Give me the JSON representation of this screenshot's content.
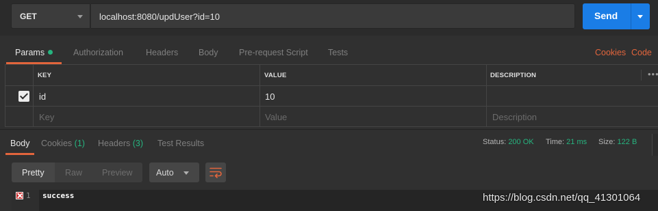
{
  "request": {
    "method": "GET",
    "url": "localhost:8080/updUser?id=10",
    "send_label": "Send"
  },
  "tabs": {
    "params": "Params",
    "authorization": "Authorization",
    "headers": "Headers",
    "body": "Body",
    "prerequest": "Pre-request Script",
    "tests": "Tests",
    "cookies": "Cookies",
    "code": "Code"
  },
  "params_table": {
    "headers": {
      "key": "KEY",
      "value": "VALUE",
      "description": "DESCRIPTION"
    },
    "rows": [
      {
        "checked": true,
        "key": "id",
        "value": "10",
        "description": ""
      }
    ],
    "placeholders": {
      "key": "Key",
      "value": "Value",
      "description": "Description"
    }
  },
  "response": {
    "tabs": {
      "body": "Body",
      "cookies": "Cookies",
      "cookies_count": "(1)",
      "headers": "Headers",
      "headers_count": "(3)",
      "test_results": "Test Results"
    },
    "status_label": "Status:",
    "status_value": "200 OK",
    "time_label": "Time:",
    "time_value": "21 ms",
    "size_label": "Size:",
    "size_value": "122 B",
    "view_modes": [
      "Pretty",
      "Raw",
      "Preview"
    ],
    "format": "Auto",
    "lines": [
      {
        "number": "1",
        "text": "success"
      }
    ]
  },
  "watermark": "https://blog.csdn.net/qq_41301064",
  "colors": {
    "accent": "#e2653c",
    "send": "#1a7de6",
    "success": "#26b47f"
  }
}
